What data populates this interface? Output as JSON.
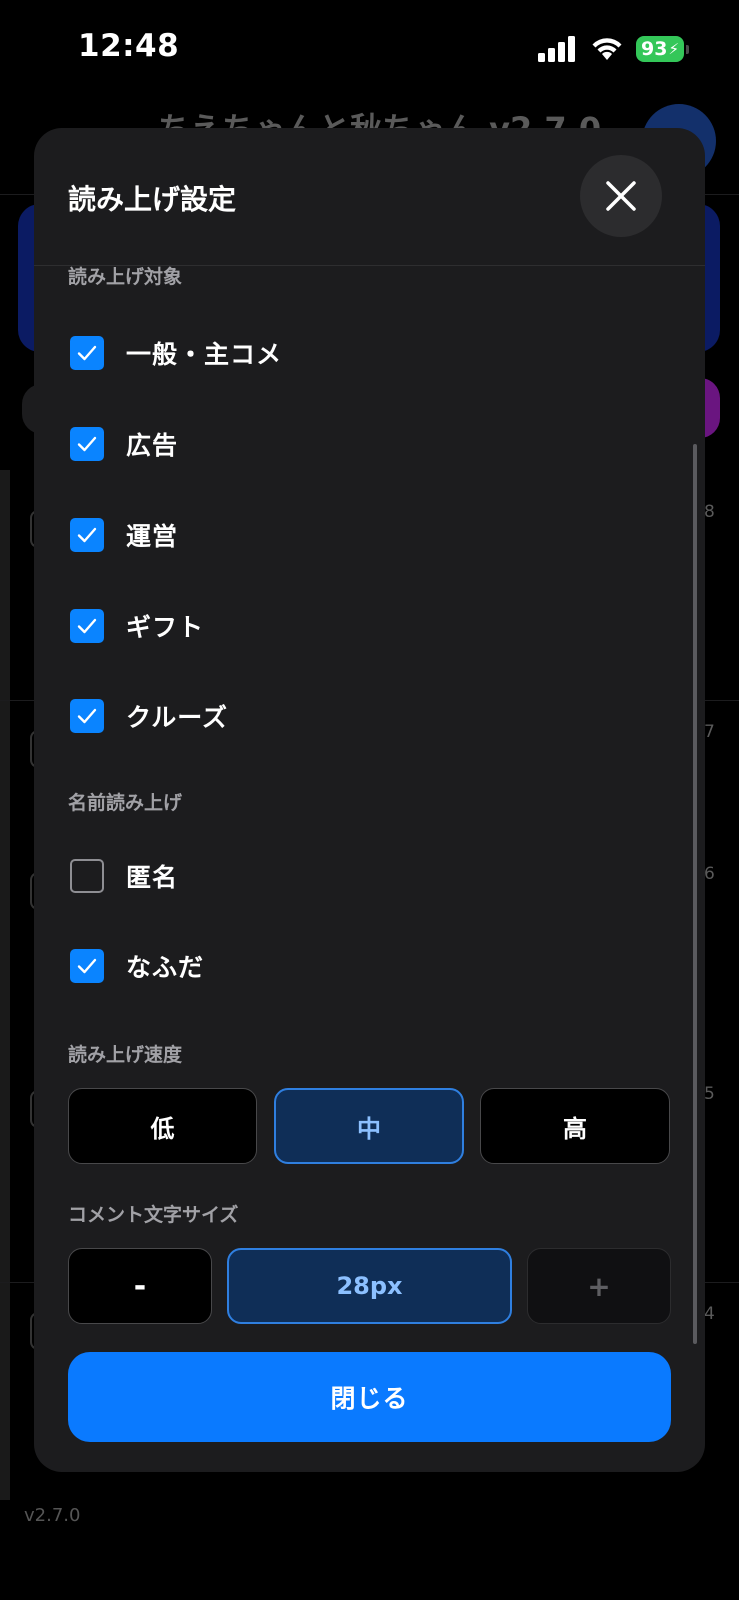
{
  "status_bar": {
    "time": "12:48",
    "battery_level": "93",
    "icons": [
      "signal-icon",
      "wifi-icon",
      "battery-icon",
      "charging-bolt-icon"
    ]
  },
  "background": {
    "app_title": "ちえちゃんと秋ちゃん v2.7.0",
    "side_numbers": [
      "8",
      "7",
      "6",
      "5",
      "4"
    ],
    "version_footer": "v2.7.0"
  },
  "modal": {
    "title": "読み上げ設定",
    "close_icon": "close-icon",
    "read_targets": {
      "label": "読み上げ対象",
      "items": [
        {
          "label": "一般・主コメ",
          "checked": true
        },
        {
          "label": "広告",
          "checked": true
        },
        {
          "label": "運営",
          "checked": true
        },
        {
          "label": "ギフト",
          "checked": true
        },
        {
          "label": "クルーズ",
          "checked": true
        }
      ]
    },
    "name_reading": {
      "label": "名前読み上げ",
      "items": [
        {
          "label": "匿名",
          "checked": false
        },
        {
          "label": "なふだ",
          "checked": true
        }
      ]
    },
    "speed": {
      "label": "読み上げ速度",
      "options": [
        "低",
        "中",
        "高"
      ],
      "selected": "中"
    },
    "font_size": {
      "label": "コメント文字サイズ",
      "decrement": "-",
      "value": "28px",
      "increment": "+"
    },
    "close_button_label": "閉じる"
  },
  "colors": {
    "accent": "#0a84ff",
    "modal_bg": "#1c1c1e",
    "selected_bg": "#0f2e57",
    "battery": "#34c759"
  }
}
